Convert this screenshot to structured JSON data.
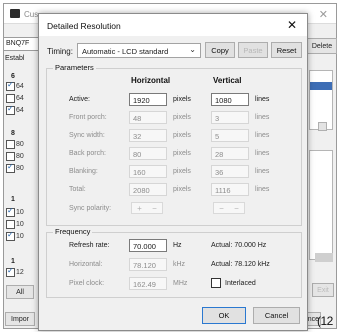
{
  "background": {
    "title": "Cus",
    "combo_value": "BNQ7F",
    "section_label": "Establ",
    "group_digits": [
      "6",
      "8",
      "1",
      "1"
    ],
    "checkbox_labels": [
      "64",
      "64",
      "64",
      "80",
      "80",
      "80",
      "10",
      "10",
      "10",
      "12"
    ],
    "all_button": "All",
    "import_button": "Impor",
    "delete_button": "Delete",
    "right_button_fragment": "nce",
    "bottom_right_button": "Exit"
  },
  "corner_mark": "(12",
  "dialog": {
    "title": "Detailed Resolution",
    "timing_label": "Timing:",
    "timing_value": "Automatic - LCD standard",
    "copy_label": "Copy",
    "paste_label": "Paste",
    "reset_label": "Reset",
    "parameters_title": "Parameters",
    "horizontal_header": "Horizontal",
    "vertical_header": "Vertical",
    "rows": [
      {
        "label": "Active:",
        "h": "1920",
        "h_unit": "pixels",
        "v": "1080",
        "v_unit": "lines"
      },
      {
        "label": "Front porch:",
        "h": "48",
        "h_unit": "pixels",
        "v": "3",
        "v_unit": "lines"
      },
      {
        "label": "Sync width:",
        "h": "32",
        "h_unit": "pixels",
        "v": "5",
        "v_unit": "lines"
      },
      {
        "label": "Back porch:",
        "h": "80",
        "h_unit": "pixels",
        "v": "28",
        "v_unit": "lines"
      },
      {
        "label": "Blanking:",
        "h": "160",
        "h_unit": "pixels",
        "v": "36",
        "v_unit": "lines"
      },
      {
        "label": "Total:",
        "h": "2080",
        "h_unit": "pixels",
        "v": "1116",
        "v_unit": "lines"
      }
    ],
    "sync_polarity_label": "Sync polarity:",
    "sync_h_plus": "+",
    "sync_h_minus": "−",
    "sync_v_plus": "−",
    "sync_v_minus": "−",
    "frequency_title": "Frequency",
    "refresh_label": "Refresh rate:",
    "refresh_value": "70.000",
    "refresh_unit": "Hz",
    "refresh_actual": "Actual: 70.000 Hz",
    "horizontal_label": "Horizontal:",
    "horizontal_value": "78.120",
    "horizontal_unit": "kHz",
    "horizontal_actual": "Actual: 78.120 kHz",
    "pixel_clock_label": "Pixel clock:",
    "pixel_clock_value": "162.49",
    "pixel_clock_unit": "MHz",
    "interlaced_label": "Interlaced",
    "ok_label": "OK",
    "cancel_label": "Cancel"
  }
}
